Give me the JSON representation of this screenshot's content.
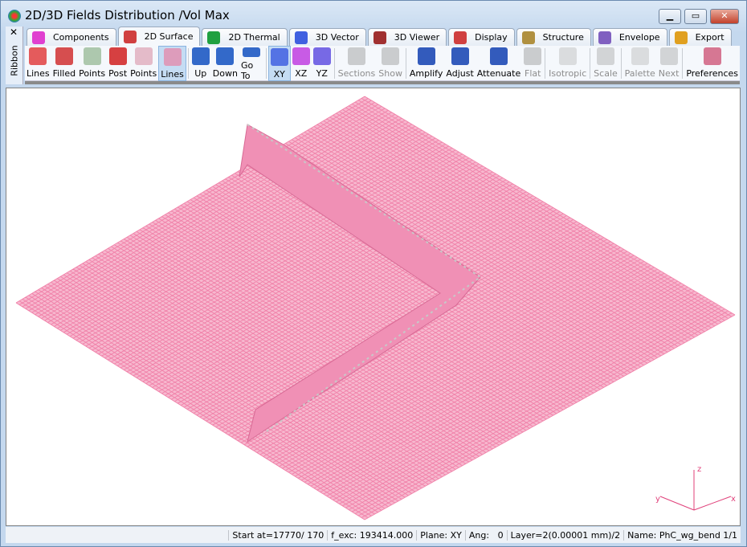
{
  "window": {
    "title": "2D/3D Fields Distribution /Vol Max",
    "controls": [
      "▁",
      "▭",
      "✕"
    ]
  },
  "ribbon": {
    "close": "✕",
    "label": "Ribbon"
  },
  "tabs": [
    {
      "label": "Components",
      "icon": "components-icon",
      "color": "#e040d0"
    },
    {
      "label": "2D Surface",
      "icon": "surface-icon",
      "color": "#d04040",
      "active": true
    },
    {
      "label": "2D Thermal",
      "icon": "thermal-icon",
      "color": "#20a040"
    },
    {
      "label": "3D Vector",
      "icon": "vector-icon",
      "color": "#4060e0"
    },
    {
      "label": "3D Viewer",
      "icon": "viewer-icon",
      "color": "#a03030"
    },
    {
      "label": "Display",
      "icon": "display-icon",
      "color": "#d04040"
    },
    {
      "label": "Structure",
      "icon": "structure-icon",
      "color": "#b09040"
    },
    {
      "label": "Envelope",
      "icon": "envelope-icon",
      "color": "#8060c0"
    },
    {
      "label": "Export",
      "icon": "export-icon",
      "color": "#e0a020"
    }
  ],
  "toolbar": [
    {
      "label": "Lines",
      "icon": "mesh-lines-icon",
      "color": "#e04040"
    },
    {
      "label": "Filled",
      "icon": "mesh-filled-icon",
      "color": "#d03030"
    },
    {
      "label": "Points",
      "icon": "points-icon",
      "color": "#a0c0a0"
    },
    {
      "label": "Post",
      "icon": "post-icon",
      "color": "#d02020"
    },
    {
      "label": "Points",
      "icon": "pink-points-icon",
      "color": "#e0b0c0"
    },
    {
      "label": "Lines",
      "icon": "pink-lines-icon",
      "color": "#e090b0",
      "selected": true
    },
    {
      "sep": true
    },
    {
      "label": "Up",
      "icon": "layer-up-icon",
      "color": "#1050c0"
    },
    {
      "label": "Down",
      "icon": "layer-down-icon",
      "color": "#1050c0"
    },
    {
      "label": "Go To",
      "icon": "layer-goto-icon",
      "color": "#1050c0"
    },
    {
      "sep": true
    },
    {
      "label": "XY",
      "icon": "plane-xy-icon",
      "color": "#4060e0",
      "selected": true
    },
    {
      "label": "XZ",
      "icon": "plane-xz-icon",
      "color": "#c040e0"
    },
    {
      "label": "YZ",
      "icon": "plane-yz-icon",
      "color": "#6050e0"
    },
    {
      "sep": true
    },
    {
      "label": "Sections",
      "icon": "sections-icon",
      "color": "#a0a0a0",
      "disabled": true
    },
    {
      "label": "Show",
      "icon": "show-icon",
      "color": "#a0a0a0",
      "disabled": true
    },
    {
      "sep": true
    },
    {
      "label": "Amplify",
      "icon": "amplify-icon",
      "color": "#1040b0"
    },
    {
      "label": "Adjust",
      "icon": "adjust-icon",
      "color": "#1040b0"
    },
    {
      "label": "Attenuate",
      "icon": "attenuate-icon",
      "color": "#1040b0"
    },
    {
      "label": "Flat",
      "icon": "flat-icon",
      "color": "#a0a0a0",
      "disabled": true
    },
    {
      "sep": true
    },
    {
      "label": "Isotropic",
      "icon": "isotropic-icon",
      "color": "#c0c0c0",
      "disabled": true
    },
    {
      "sep": true
    },
    {
      "label": "Scale",
      "icon": "scale-icon",
      "color": "#b0b0b0",
      "disabled": true
    },
    {
      "sep": true
    },
    {
      "label": "Palette",
      "icon": "palette-icon",
      "color": "#c0c0c0",
      "disabled": true
    },
    {
      "label": "Next",
      "icon": "next-icon",
      "color": "#b0b0b0",
      "disabled": true
    },
    {
      "sep": true
    },
    {
      "label": "Preferences",
      "icon": "preferences-icon",
      "color": "#d06080"
    }
  ],
  "plot": {
    "mesh_color": "#f080a8",
    "axis_color": "#e0407a",
    "axes": [
      "z",
      "x",
      "y"
    ]
  },
  "status": [
    "Start at=17770/ 170",
    "f_exc: 193414.000",
    "Plane: XY",
    "Ang:   0",
    "Layer=2(0.00001 mm)/2",
    "Name: PhC_wg_bend 1/1"
  ]
}
